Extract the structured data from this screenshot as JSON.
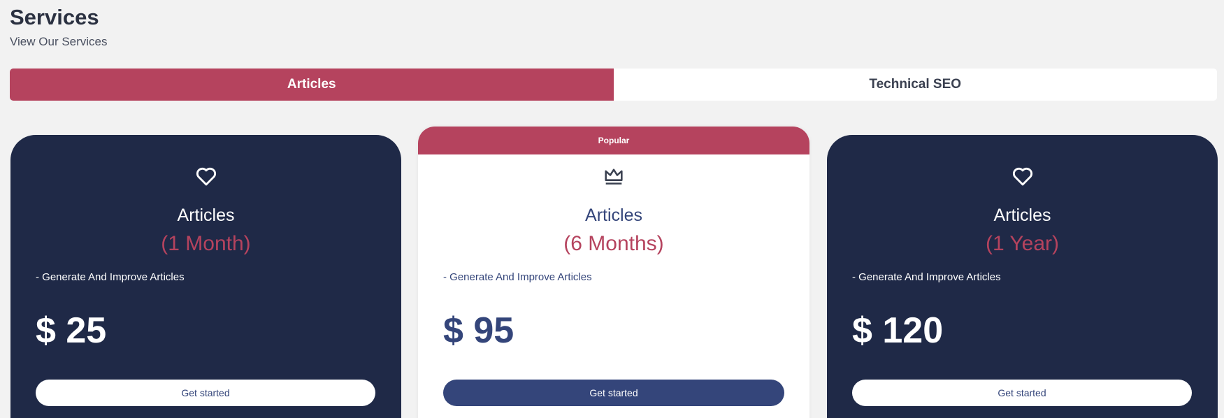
{
  "header": {
    "title": "Services",
    "subtitle": "View Our Services"
  },
  "tabs": [
    {
      "label": "Articles",
      "active": true
    },
    {
      "label": "Technical SEO",
      "active": false
    }
  ],
  "colors": {
    "accent": "#b5435e",
    "dark_card": "#1f2947",
    "navy": "#34457a",
    "background": "#f2f2f2"
  },
  "cards": [
    {
      "icon": "heart-icon",
      "badge": "",
      "name": "Articles",
      "period": "(1 Month)",
      "feature": "- Generate And Improve Articles",
      "price": "$ 25",
      "button": "Get started"
    },
    {
      "icon": "crown-icon",
      "badge": "Popular",
      "name": "Articles",
      "period": "(6 Months)",
      "feature": "- Generate And Improve Articles",
      "price": "$ 95",
      "button": "Get started"
    },
    {
      "icon": "heart-icon",
      "badge": "",
      "name": "Articles",
      "period": "(1 Year)",
      "feature": "- Generate And Improve Articles",
      "price": "$ 120",
      "button": "Get started"
    }
  ]
}
